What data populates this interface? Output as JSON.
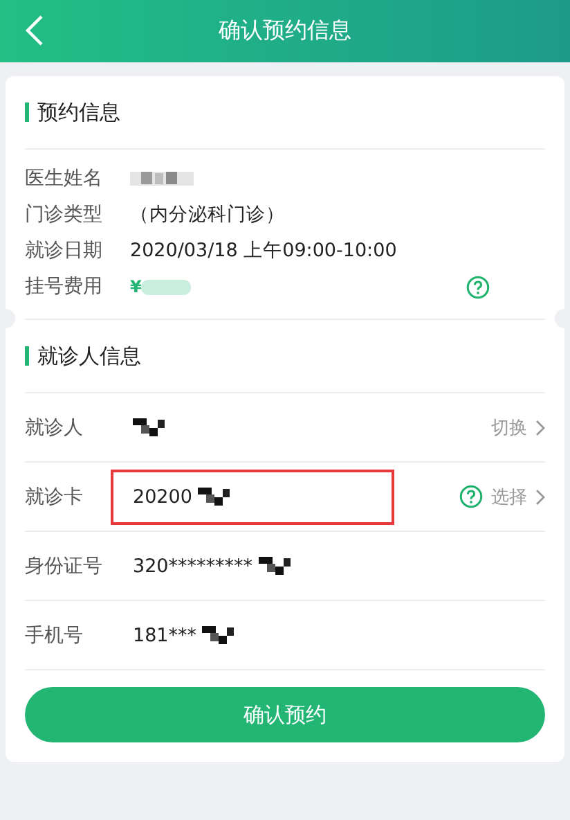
{
  "header": {
    "title": "确认预约信息"
  },
  "appointment": {
    "heading": "预约信息",
    "rows": [
      {
        "label": "医生姓名",
        "kind": "redacted"
      },
      {
        "label": "门诊类型",
        "kind": "text",
        "value": "（内分泌科门诊）"
      },
      {
        "label": "就诊日期",
        "kind": "text",
        "value": "2020/03/18 上午09:00-10:00"
      },
      {
        "label": "挂号费用",
        "kind": "fee",
        "value": "¥",
        "help": true
      }
    ]
  },
  "patient": {
    "heading": "就诊人信息",
    "rows": [
      {
        "label": "就诊人",
        "redacted": true,
        "action": "切换"
      },
      {
        "label": "就诊卡",
        "value": "20200",
        "redacted": true,
        "highlighted": true,
        "help": true,
        "action": "选择"
      },
      {
        "label": "身份证号",
        "value": "320*********",
        "redacted": true
      },
      {
        "label": "手机号",
        "value": "181***",
        "redacted": true
      }
    ]
  },
  "confirm_button": "确认预约"
}
